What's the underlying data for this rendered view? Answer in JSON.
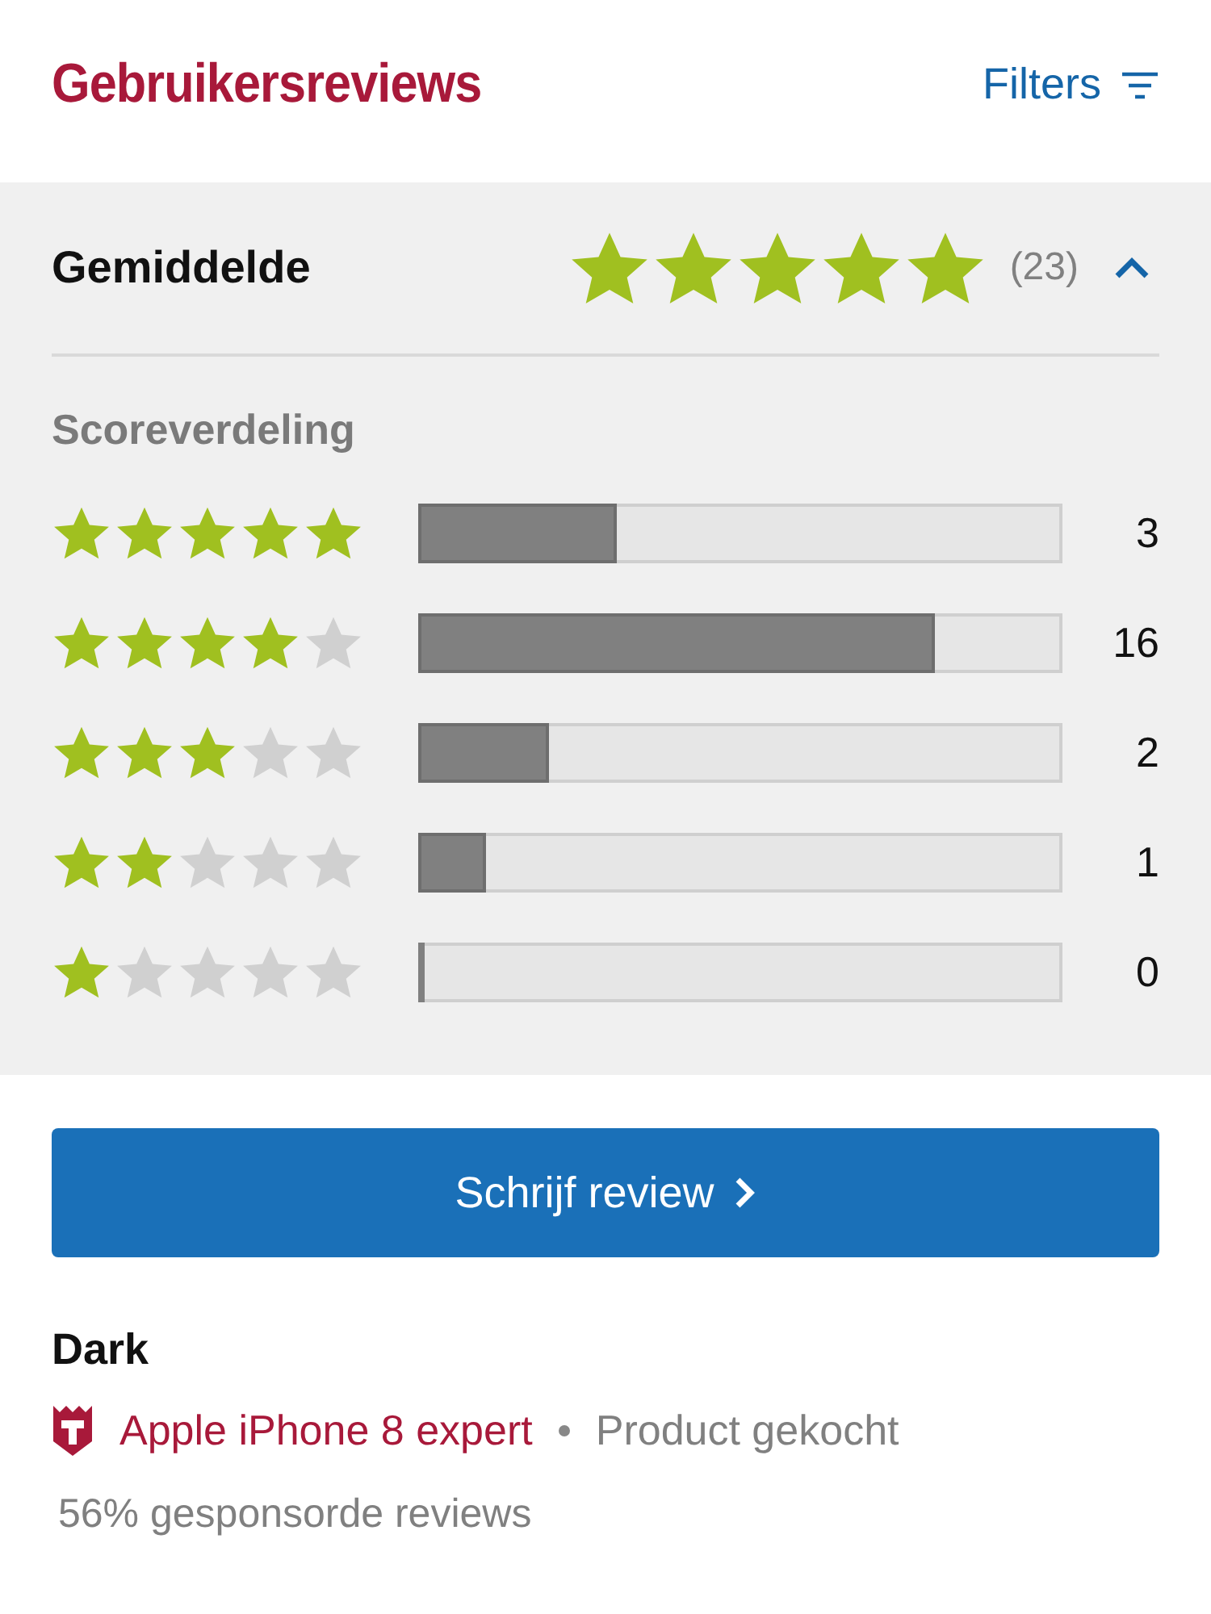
{
  "header": {
    "title": "Gebruikersreviews",
    "filters_label": "Filters"
  },
  "summary": {
    "label": "Gemiddelde",
    "stars": 5,
    "count": "(23)",
    "expanded": true
  },
  "distribution": {
    "title": "Scoreverdeling",
    "rows": [
      {
        "stars": 5,
        "level": 0.3,
        "count": "3"
      },
      {
        "stars": 4,
        "level": 0.8,
        "count": "16"
      },
      {
        "stars": 3,
        "level": 0.196,
        "count": "2"
      },
      {
        "stars": 2,
        "level": 0.095,
        "count": "1"
      },
      {
        "stars": 1,
        "level": 0,
        "count": "0"
      }
    ]
  },
  "write_button": {
    "label": "Schrijf review"
  },
  "review": {
    "author": "Dark",
    "badge": "Apple iPhone 8 expert",
    "purchase": "Product gekocht",
    "sponsored": "56% gesponsorde reviews"
  }
}
